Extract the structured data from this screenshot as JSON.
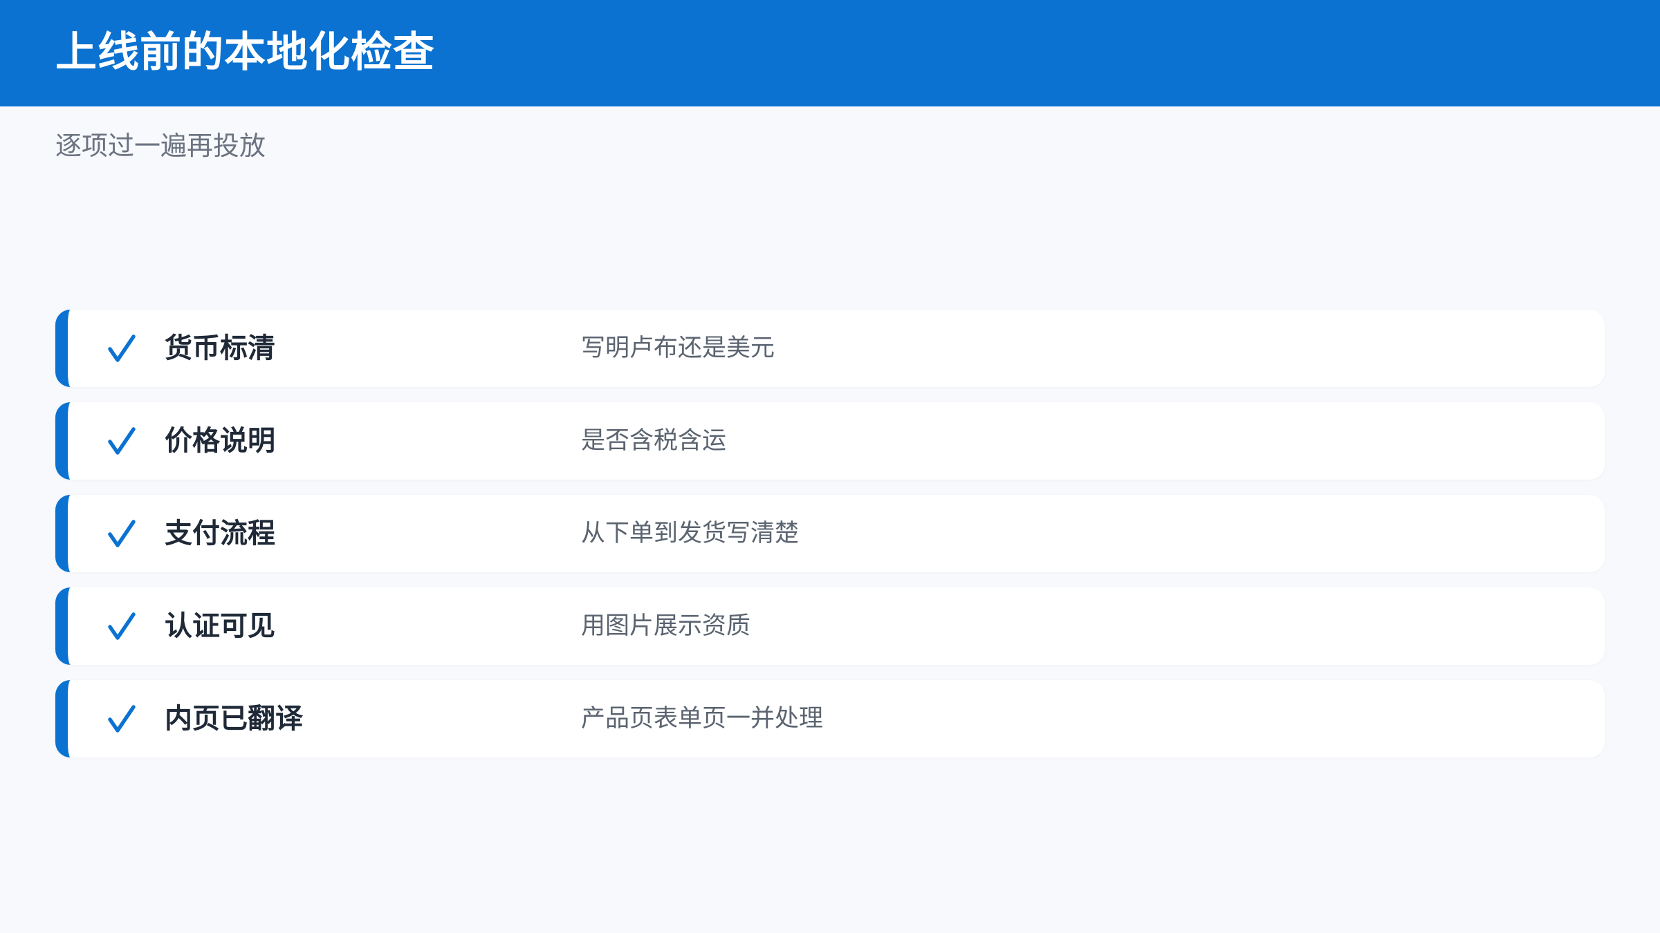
{
  "header": {
    "title": "上线前的本地化检查"
  },
  "subtitle": "逐项过一遍再投放",
  "colors": {
    "accent": "#0b72d1",
    "background": "#f7f9fc",
    "card": "#ffffff",
    "title_text": "#1f2937",
    "muted_text": "#5b6470"
  },
  "checklist": [
    {
      "icon": "checkmark-icon",
      "title": "货币标清",
      "description": "写明卢布还是美元"
    },
    {
      "icon": "checkmark-icon",
      "title": "价格说明",
      "description": "是否含税含运"
    },
    {
      "icon": "checkmark-icon",
      "title": "支付流程",
      "description": "从下单到发货写清楚"
    },
    {
      "icon": "checkmark-icon",
      "title": "认证可见",
      "description": "用图片展示资质"
    },
    {
      "icon": "checkmark-icon",
      "title": "内页已翻译",
      "description": "产品页表单页一并处理"
    }
  ]
}
